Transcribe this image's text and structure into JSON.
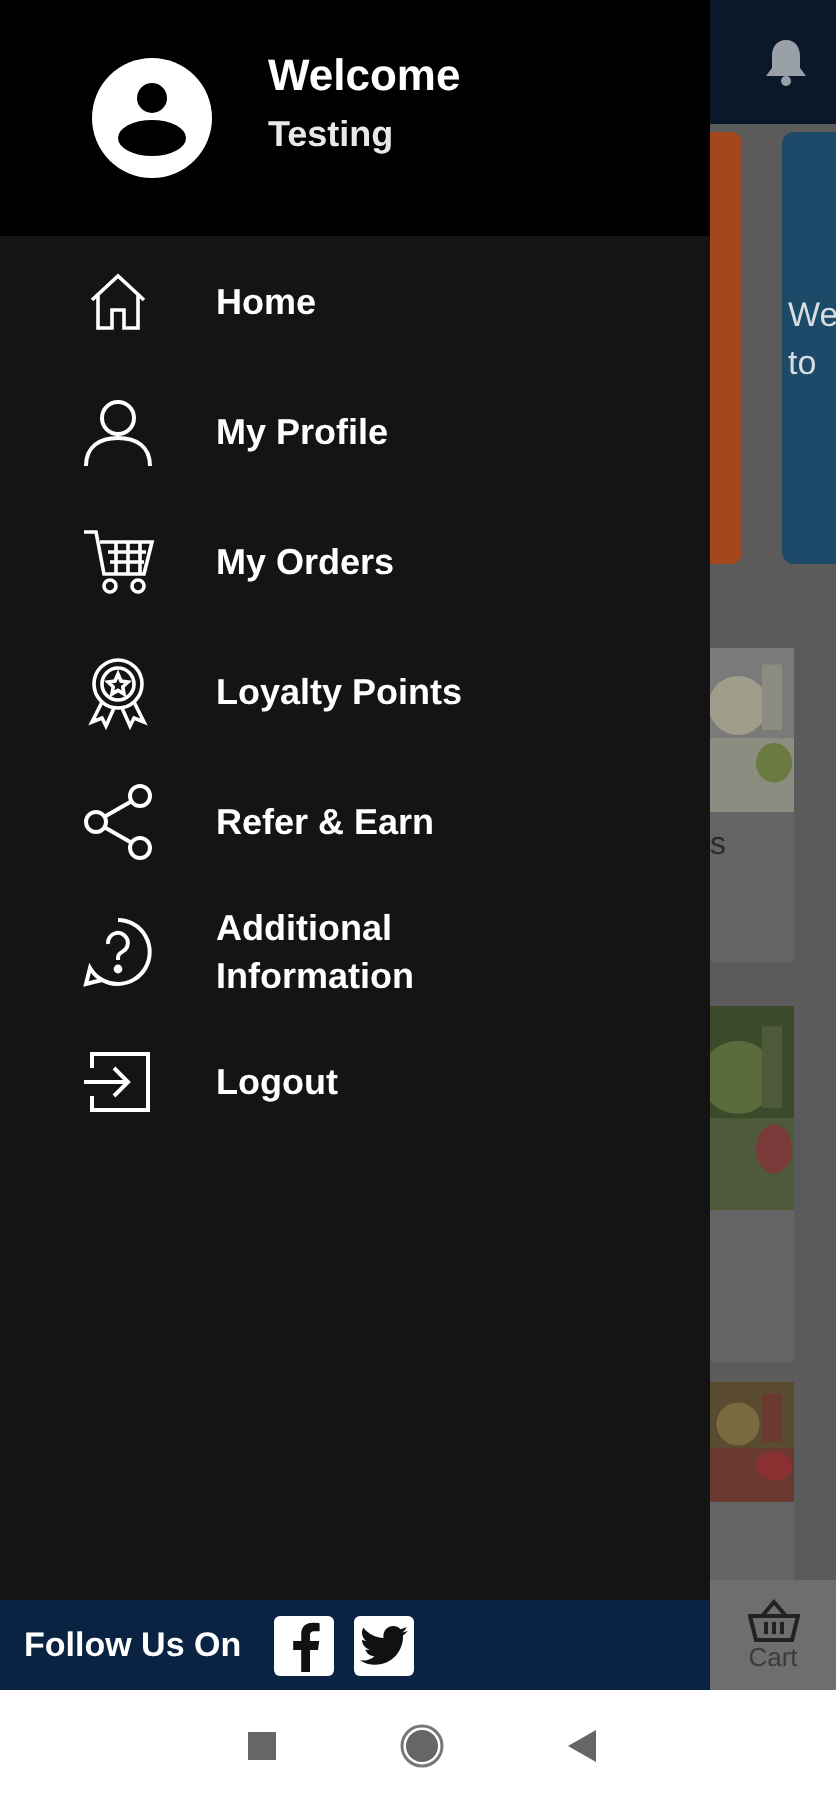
{
  "drawer": {
    "header": {
      "title": "Welcome",
      "subtitle": "Testing"
    },
    "menu": [
      {
        "kind": "home",
        "label": "Home"
      },
      {
        "kind": "profile",
        "label": "My Profile"
      },
      {
        "kind": "orders",
        "label": "My Orders"
      },
      {
        "kind": "loyalty",
        "label": "Loyalty Points"
      },
      {
        "kind": "share",
        "label": "Refer & Earn"
      },
      {
        "kind": "help",
        "label": "Additional Information"
      },
      {
        "kind": "logout",
        "label": "Logout"
      }
    ],
    "footer": {
      "label": "Follow Us On",
      "socials": [
        {
          "kind": "facebook"
        },
        {
          "kind": "twitter"
        }
      ]
    }
  },
  "background_app": {
    "banner_text": [
      "We",
      "to"
    ],
    "card_caption": "s",
    "bottom_nav": [
      {
        "label": "Cart"
      }
    ]
  }
}
